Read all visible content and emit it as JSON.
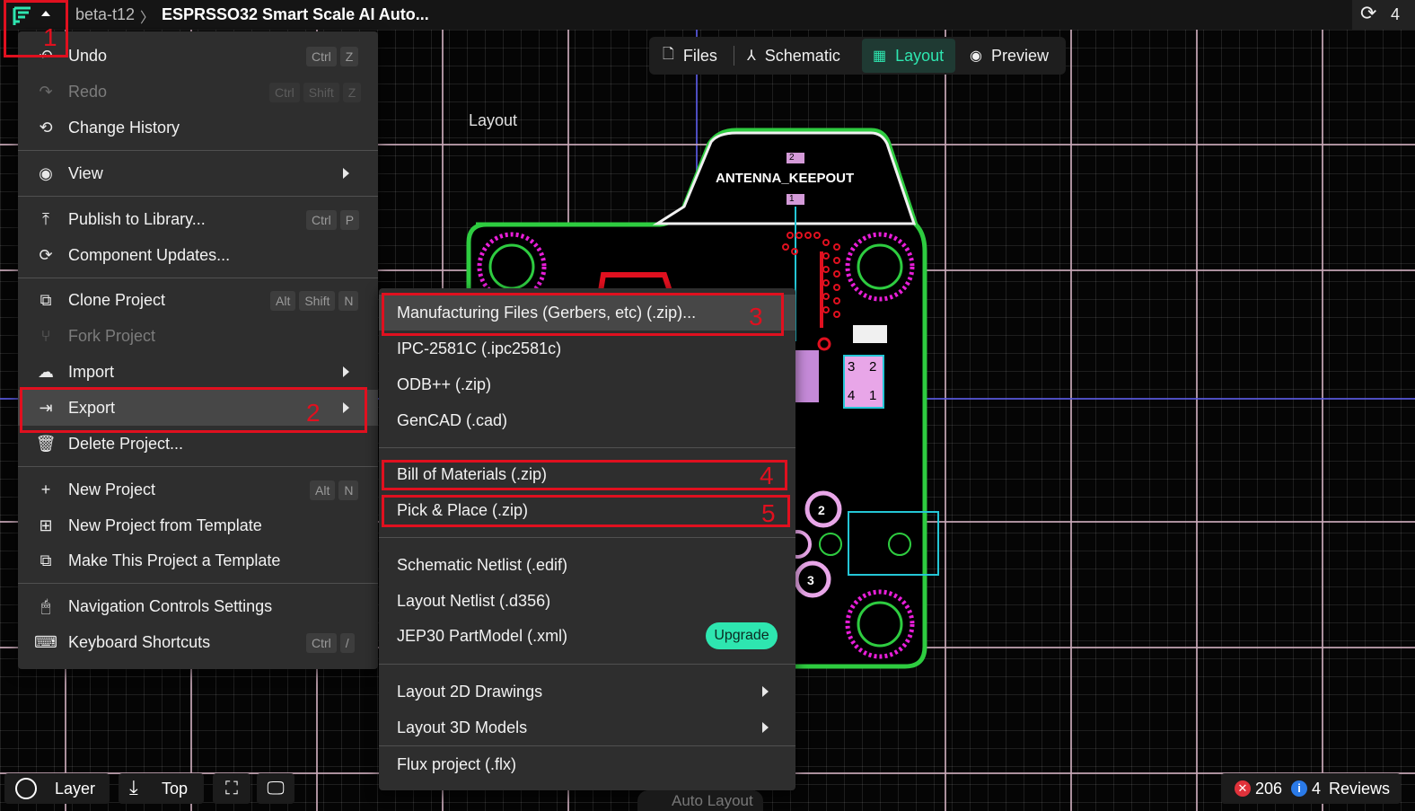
{
  "topbar": {
    "workspace": "beta-t12",
    "separator": "〉",
    "project_title": "ESPRSSO32 Smart Scale AI Auto...",
    "sync_count": "4"
  },
  "view_tabs": [
    {
      "label": "Files",
      "icon": "file-icon",
      "active": false
    },
    {
      "label": "Schematic",
      "icon": "schematic-icon",
      "active": false
    },
    {
      "label": "Layout",
      "icon": "layout-icon",
      "active": true
    },
    {
      "label": "Preview",
      "icon": "eye-icon",
      "active": false
    }
  ],
  "canvas": {
    "layout_label": "Layout",
    "keepout_label": "ANTENNA_KEEPOUT",
    "pad_labels": [
      "2",
      "1",
      "3",
      "2",
      "4",
      "1",
      "2",
      "3",
      "1"
    ]
  },
  "main_menu": {
    "items": [
      {
        "label": "Undo",
        "icon": "undo-icon",
        "shortcut": [
          "Ctrl",
          "Z"
        ],
        "disabled": false
      },
      {
        "label": "Redo",
        "icon": "redo-icon",
        "shortcut": [
          "Ctrl",
          "Shift",
          "Z"
        ],
        "disabled": true
      },
      {
        "label": "Change History",
        "icon": "history-icon",
        "shortcut": [],
        "disabled": false
      },
      {
        "label": "View",
        "icon": "eye-icon",
        "submenu": true
      },
      {
        "label": "Publish to Library...",
        "icon": "publish-icon",
        "shortcut": [
          "Ctrl",
          "P"
        ]
      },
      {
        "label": "Component Updates...",
        "icon": "refresh-icon"
      },
      {
        "label": "Clone Project",
        "icon": "copy-icon",
        "shortcut": [
          "Alt",
          "Shift",
          "N"
        ]
      },
      {
        "label": "Fork Project",
        "icon": "fork-icon",
        "disabled": true
      },
      {
        "label": "Import",
        "icon": "cloud-upload-icon",
        "submenu": true
      },
      {
        "label": "Export",
        "icon": "export-icon",
        "submenu": true
      },
      {
        "label": "Delete Project...",
        "icon": "trash-icon"
      },
      {
        "label": "New Project",
        "icon": "plus-icon",
        "shortcut": [
          "Alt",
          "N"
        ]
      },
      {
        "label": "New Project from Template",
        "icon": "plus-box-icon"
      },
      {
        "label": "Make This Project a Template",
        "icon": "template-icon"
      },
      {
        "label": "Navigation Controls Settings",
        "icon": "mouse-icon"
      },
      {
        "label": "Keyboard Shortcuts",
        "icon": "keyboard-icon",
        "shortcut": [
          "Ctrl",
          "/"
        ]
      }
    ]
  },
  "export_menu": {
    "items": [
      {
        "label": "Manufacturing Files (Gerbers, etc) (.zip)..."
      },
      {
        "label": "IPC-2581C (.ipc2581c)"
      },
      {
        "label": "ODB++ (.zip)"
      },
      {
        "label": "GenCAD (.cad)"
      },
      {
        "label": "Bill of Materials (.zip)"
      },
      {
        "label": "Pick & Place (.zip)"
      },
      {
        "label": "Schematic Netlist (.edif)"
      },
      {
        "label": "Layout Netlist (.d356)"
      },
      {
        "label": "JEP30 PartModel (.xml)",
        "badge": "Upgrade"
      },
      {
        "label": "Layout 2D Drawings",
        "submenu": true
      },
      {
        "label": "Layout 3D Models",
        "submenu": true
      },
      {
        "label": "Flux project (.flx)"
      }
    ]
  },
  "annotations": [
    "1",
    "2",
    "3",
    "4",
    "5"
  ],
  "bottombar": {
    "layer_label": "Layer",
    "side_label": "Top",
    "hidden_button": "Auto Layout",
    "error_count": "206",
    "info_count": "4",
    "reviews_label": "Reviews"
  },
  "colors": {
    "accent": "#2ee6b0",
    "annotation_red": "#e0101f",
    "board_outline": "#2ecc40",
    "pad_magenta": "#e81ed8"
  }
}
